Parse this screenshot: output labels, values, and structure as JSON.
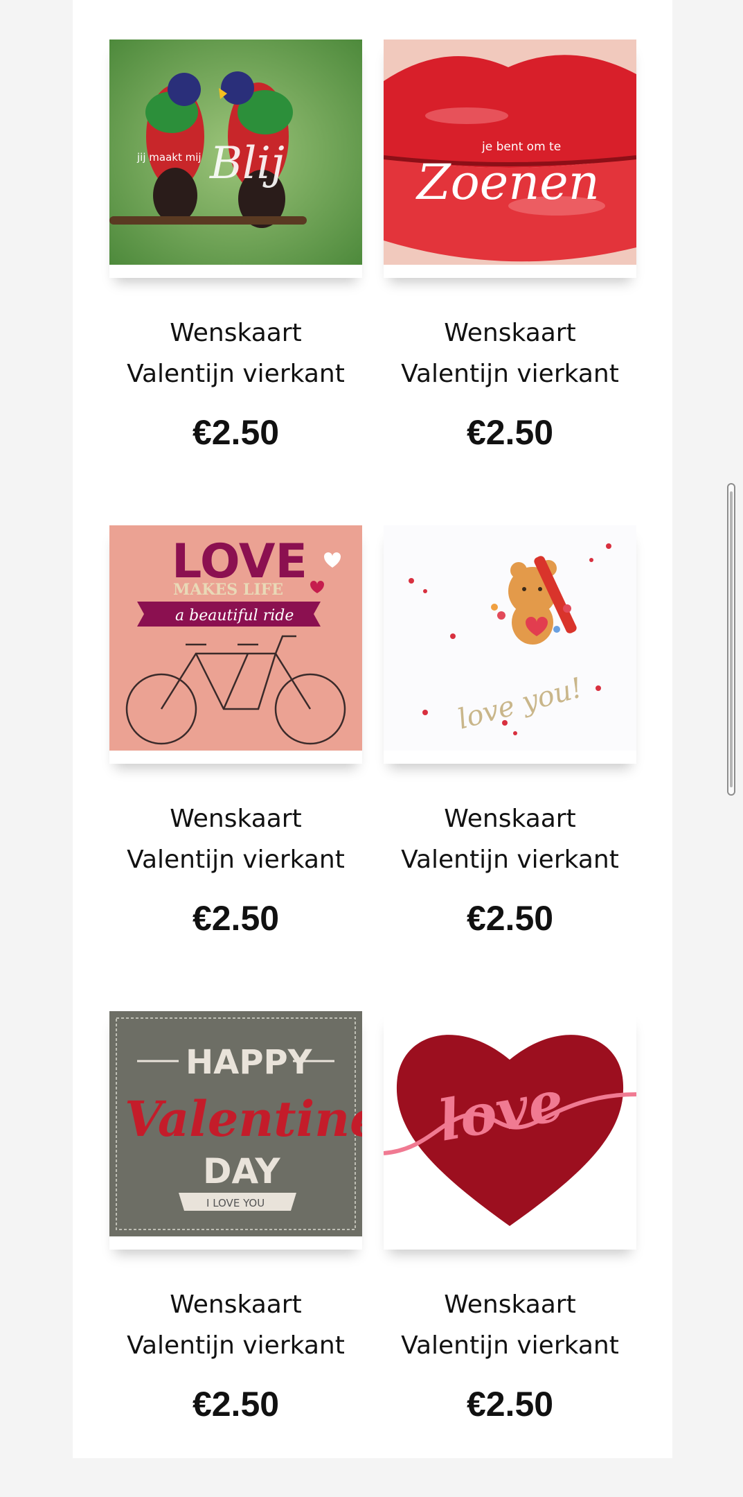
{
  "products": [
    {
      "title_line1": "Wenskaart",
      "title_line2": "Valentijn vierkant",
      "price": "€2.50",
      "image_icon": "lovebirds-card-image",
      "image_text": [
        "jij maakt mij",
        "Blij"
      ]
    },
    {
      "title_line1": "Wenskaart",
      "title_line2": "Valentijn vierkant",
      "price": "€2.50",
      "image_icon": "red-lips-card-image",
      "image_text": [
        "je bent om te",
        "Zoenen"
      ]
    },
    {
      "title_line1": "Wenskaart",
      "title_line2": "Valentijn vierkant",
      "price": "€2.50",
      "image_icon": "tandem-bicycle-card-image",
      "image_text": [
        "LOVE",
        "MAKES LIFE",
        "a beautiful ride"
      ]
    },
    {
      "title_line1": "Wenskaart",
      "title_line2": "Valentijn vierkant",
      "price": "€2.50",
      "image_icon": "teddy-bear-card-image",
      "image_text": [
        "love you!"
      ]
    },
    {
      "title_line1": "Wenskaart",
      "title_line2": "Valentijn vierkant",
      "price": "€2.50",
      "image_icon": "happy-valentines-card-image",
      "image_text": [
        "HAPPY",
        "Valentine's",
        "DAY",
        "I LOVE YOU"
      ]
    },
    {
      "title_line1": "Wenskaart",
      "title_line2": "Valentijn vierkant",
      "price": "€2.50",
      "image_icon": "red-heart-love-card-image",
      "image_text": [
        "love"
      ]
    }
  ],
  "colors": {
    "page_background": "#f4f4f4",
    "content_background": "#ffffff",
    "text": "#111111"
  }
}
